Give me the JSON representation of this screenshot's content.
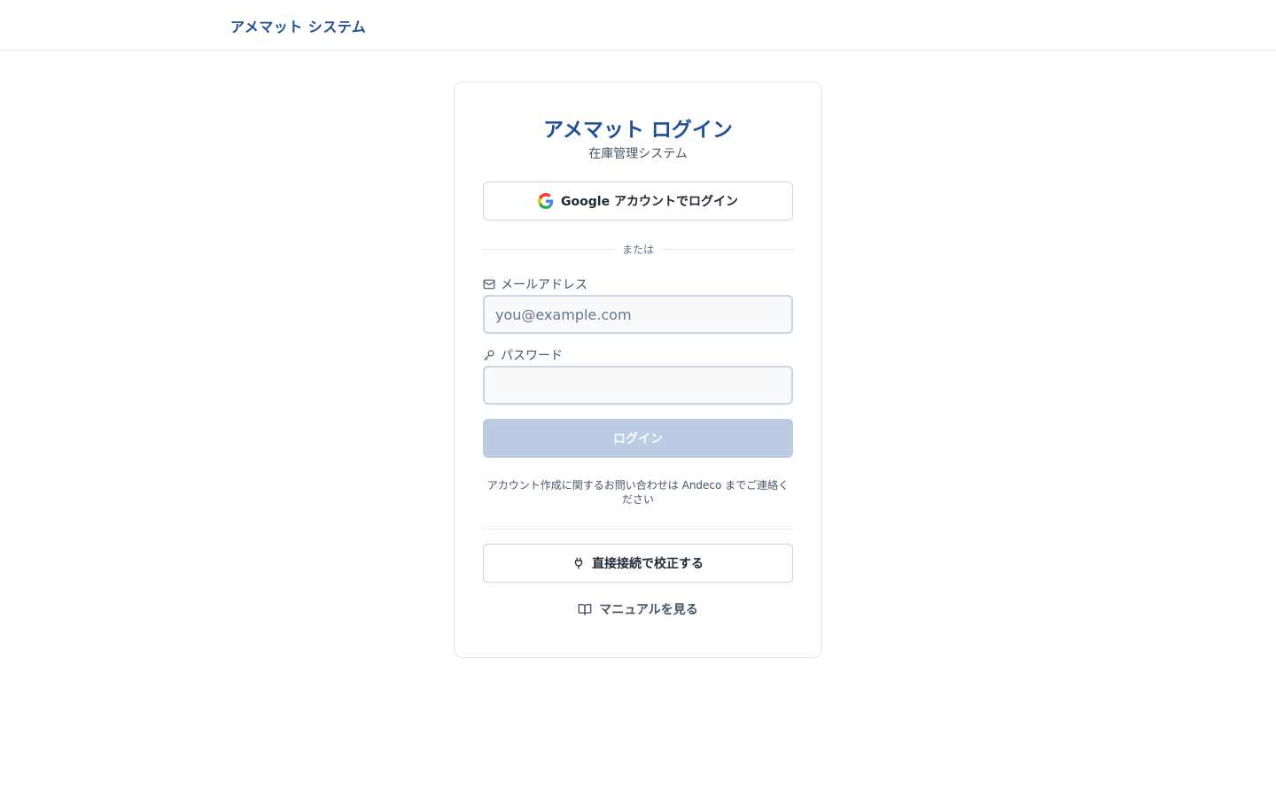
{
  "header": {
    "brand": "アメマット システム"
  },
  "card": {
    "title": "アメマット ログイン",
    "subtitle": "在庫管理システム",
    "google_button": "Google アカウントでログイン",
    "divider_text": "または",
    "email": {
      "label": "メールアドレス",
      "placeholder": "you@example.com",
      "value": ""
    },
    "password": {
      "label": "パスワード",
      "placeholder": "",
      "value": ""
    },
    "login_button": "ログイン",
    "note": "アカウント作成に関するお問い合わせは Andeco までご連絡ください",
    "calibrate_button": "直接接続で校正する",
    "manual_link": "マニュアルを見る"
  },
  "icons": {
    "google": "google-icon",
    "mail": "mail-icon",
    "key": "key-icon",
    "plug": "plug-icon",
    "book": "book-open-icon"
  },
  "colors": {
    "brand": "#1e4f99",
    "login_button_disabled": "#bacbe3",
    "border": "#cbd5e1"
  }
}
